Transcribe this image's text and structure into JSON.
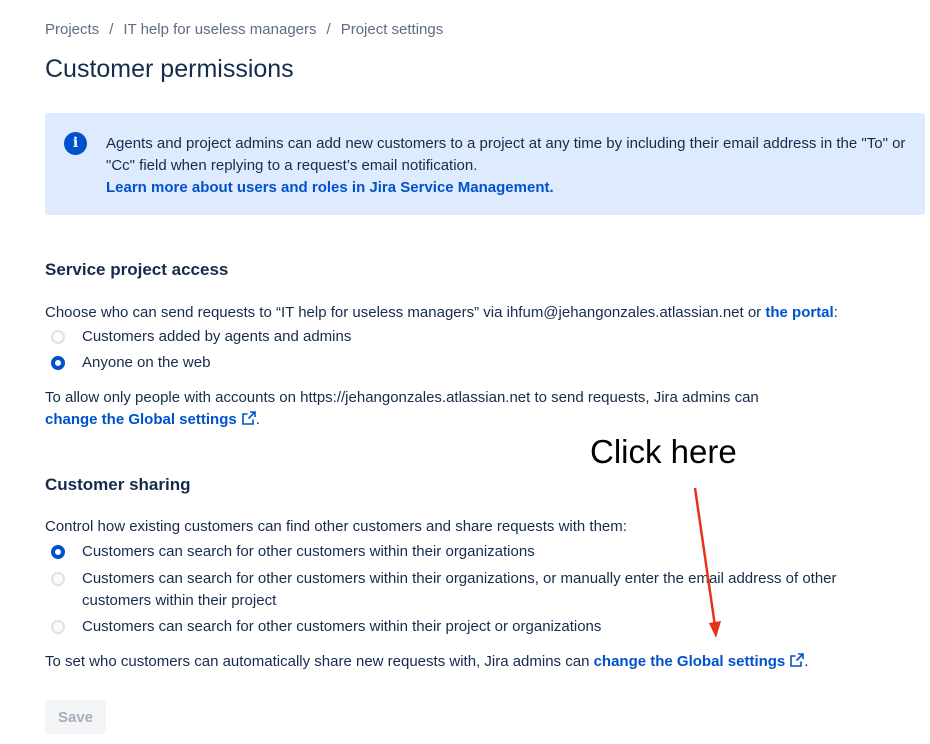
{
  "breadcrumb": {
    "items": [
      "Projects",
      "IT help for useless managers",
      "Project settings"
    ],
    "separator": "/"
  },
  "page": {
    "title": "Customer permissions"
  },
  "info": {
    "text": "Agents and project admins can add new customers to a project at any time by including their email address in the \"To\" or \"Cc\" field when replying to a request’s email notification.",
    "link": "Learn more about users and roles in Jira Service Management."
  },
  "access": {
    "heading": "Service project access",
    "intro_prefix": "Choose who can send requests to “IT help for useless managers” via ihfum@jehangonzales.atlassian.net or ",
    "intro_link": "the portal",
    "intro_suffix": ":",
    "options": [
      {
        "label": "Customers added by agents and admins",
        "checked": false
      },
      {
        "label": "Anyone on the web",
        "checked": true
      }
    ],
    "note": "To allow only people with accounts on https://jehangonzales.atlassian.net to send requests, Jira admins can",
    "note_link": "change the Global settings",
    "note_end": "."
  },
  "sharing": {
    "heading": "Customer sharing",
    "intro": "Control how existing customers can find other customers and share requests with them:",
    "options": [
      {
        "label": "Customers can search for other customers within their organizations",
        "checked": true
      },
      {
        "label": "Customers can search for other customers within their organizations, or manually enter the email address of other customers within their project",
        "checked": false
      },
      {
        "label": "Customers can search for other customers within their project or organizations",
        "checked": false
      }
    ],
    "note": "To set who customers can automatically share new requests with, Jira admins can ",
    "note_link": "change the Global settings",
    "note_end": "."
  },
  "annotation": {
    "text": "Click here",
    "color": "#e8311a"
  },
  "buttons": {
    "save": "Save"
  },
  "colors": {
    "accent": "#0052cc",
    "info_bg": "#deebff",
    "text": "#172b4d"
  },
  "icons": {
    "info": "info-icon",
    "external": "external-link-icon"
  }
}
